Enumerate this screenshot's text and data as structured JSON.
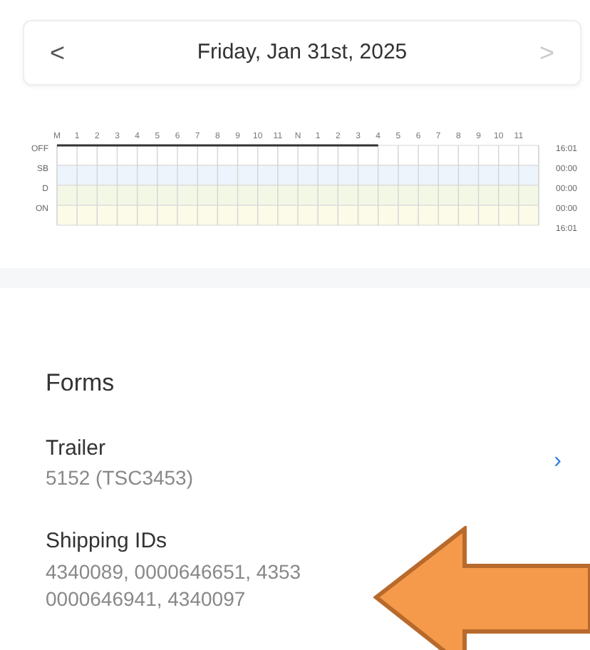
{
  "date_nav": {
    "prev": "<",
    "title": "Friday, Jan 31st, 2025",
    "next": ">"
  },
  "log_chart": {
    "hours": [
      "M",
      "1",
      "2",
      "3",
      "4",
      "5",
      "6",
      "7",
      "8",
      "9",
      "10",
      "11",
      "N",
      "1",
      "2",
      "3",
      "4",
      "5",
      "6",
      "7",
      "8",
      "9",
      "10",
      "11"
    ],
    "rows": [
      {
        "label": "OFF",
        "total": "16:01"
      },
      {
        "label": "SB",
        "total": "00:00"
      },
      {
        "label": "D",
        "total": "00:00"
      },
      {
        "label": "ON",
        "total": "00:00"
      }
    ],
    "grand_total": "16:01"
  },
  "forms": {
    "title": "Forms",
    "items": [
      {
        "label": "Trailer",
        "lines": [
          "5152 (TSC3453)"
        ],
        "chevron": "›"
      },
      {
        "label": "Shipping IDs",
        "lines": [
          "4340089, 0000646651, 4353",
          "0000646941, 4340097"
        ]
      }
    ]
  }
}
